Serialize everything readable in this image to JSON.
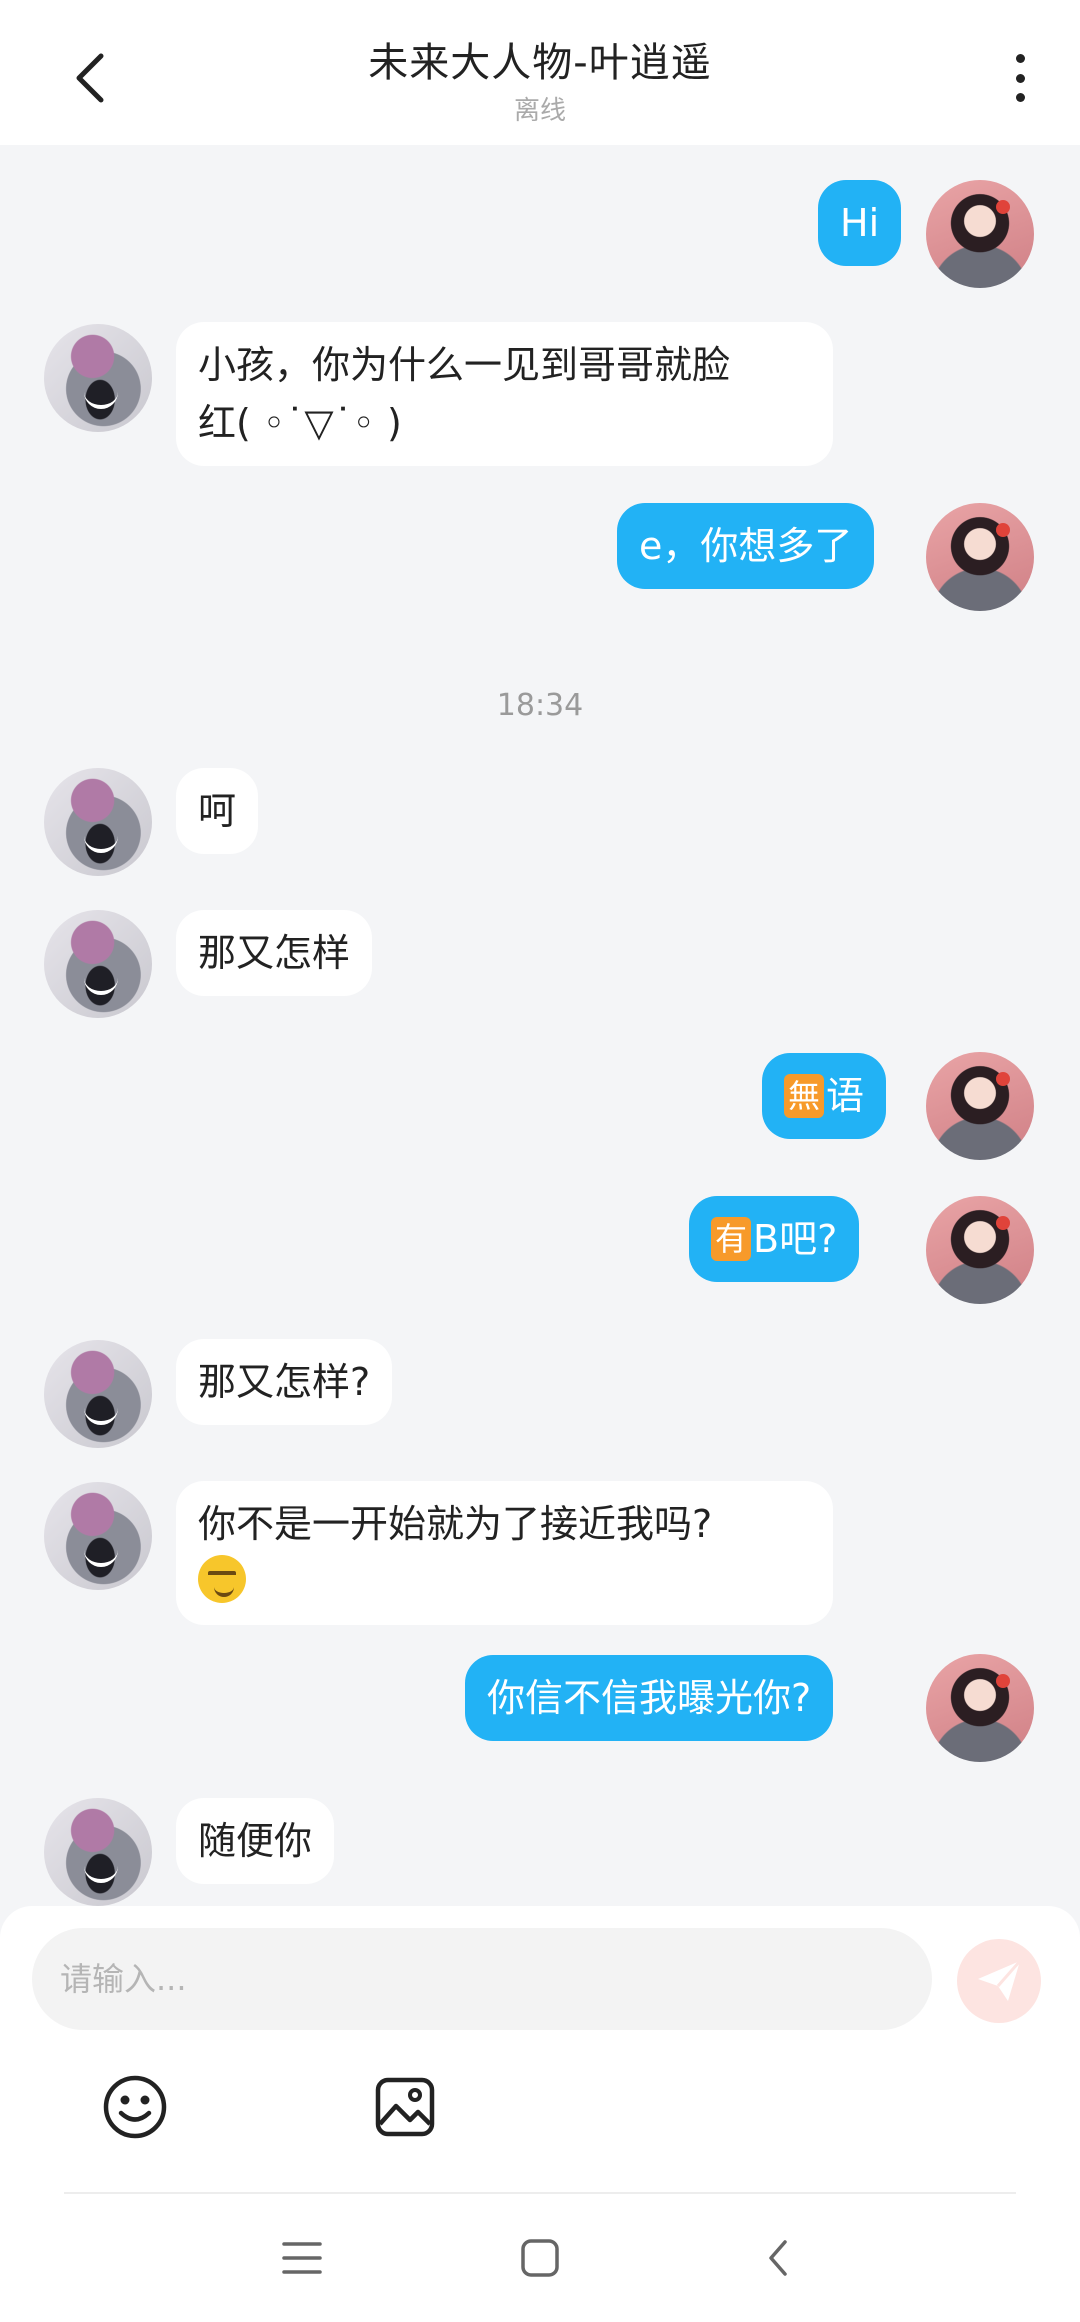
{
  "header": {
    "title": "未来大人物-叶逍遥",
    "status": "离线"
  },
  "messages": [
    {
      "sender": "me",
      "text": "Hi"
    },
    {
      "sender": "other",
      "line1": "小孩，你为什么一见到哥哥就脸",
      "line2": "红( ◦˙▽˙◦ )"
    },
    {
      "sender": "me",
      "text": "e，你想多了"
    },
    {
      "timestamp": "18:34"
    },
    {
      "sender": "other",
      "text": "呵"
    },
    {
      "sender": "other",
      "text": "那又怎样"
    },
    {
      "sender": "me",
      "badge": "無",
      "text": "语"
    },
    {
      "sender": "me",
      "badge": "有",
      "text": "B吧?"
    },
    {
      "sender": "other",
      "text": "那又怎样?"
    },
    {
      "sender": "other",
      "line1": "你不是一开始就为了接近我吗?",
      "emoji": "smirking-face"
    },
    {
      "sender": "me",
      "text": "你信不信我曝光你?"
    },
    {
      "sender": "other",
      "text": "随便你"
    }
  ],
  "input": {
    "placeholder": "请输入..."
  },
  "icons": {
    "back": "chevron-left-icon",
    "more": "more-vertical-icon",
    "send": "paper-plane-icon",
    "emoji": "smiley-icon",
    "image": "image-icon"
  },
  "colors": {
    "my_bubble": "#22b2f5",
    "other_bubble": "#ffffff",
    "send_button": "#fde4e1",
    "badge": "#f79a2a"
  }
}
